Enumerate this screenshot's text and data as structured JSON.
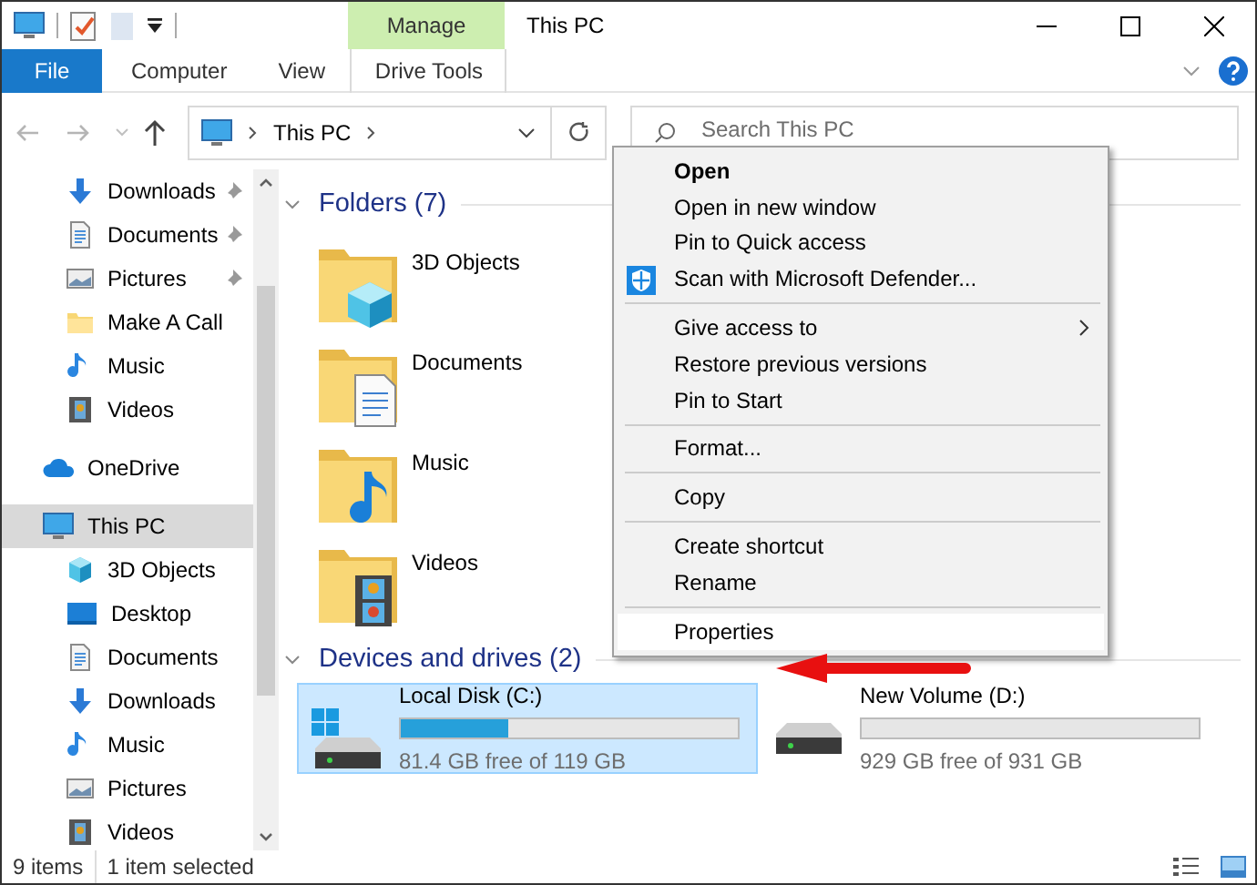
{
  "window": {
    "title": "This PC"
  },
  "ribbon": {
    "context_group": "Manage",
    "tabs": [
      {
        "label": "File",
        "kind": "file",
        "selected": false
      },
      {
        "label": "Computer",
        "kind": "tab",
        "selected": false
      },
      {
        "label": "View",
        "kind": "tab",
        "selected": false
      },
      {
        "label": "Drive Tools",
        "kind": "contextual",
        "selected": false
      }
    ]
  },
  "address_bar": {
    "path": [
      "This PC"
    ]
  },
  "search": {
    "placeholder": "Search This PC"
  },
  "sidebar": {
    "quick_access": {
      "children": [
        {
          "label": "Downloads",
          "kind": "download",
          "pinned": true,
          "selected": false
        },
        {
          "label": "Documents",
          "kind": "documents",
          "pinned": true,
          "selected": false
        },
        {
          "label": "Pictures",
          "kind": "pictures",
          "pinned": true,
          "selected": false
        },
        {
          "label": "Make A Call",
          "kind": "folder",
          "pinned": false,
          "selected": false
        },
        {
          "label": "Music",
          "kind": "music",
          "pinned": false,
          "selected": false
        },
        {
          "label": "Videos",
          "kind": "videos",
          "pinned": false,
          "selected": false
        }
      ]
    },
    "items": [
      {
        "label": "OneDrive",
        "kind": "onedrive",
        "selected": false
      },
      {
        "label": "This PC",
        "kind": "pc",
        "selected": true,
        "children": [
          {
            "label": "3D Objects",
            "kind": "objects",
            "selected": false
          },
          {
            "label": "Desktop",
            "kind": "desktop",
            "selected": false
          },
          {
            "label": "Documents",
            "kind": "documents",
            "selected": false
          },
          {
            "label": "Downloads",
            "kind": "download",
            "selected": false
          },
          {
            "label": "Music",
            "kind": "music",
            "selected": false
          },
          {
            "label": "Pictures",
            "kind": "pictures",
            "selected": false
          },
          {
            "label": "Videos",
            "kind": "videos",
            "selected": false
          }
        ]
      }
    ]
  },
  "folders": {
    "title": "Folders (7)",
    "expanded": true,
    "items": [
      {
        "label": "3D Objects",
        "kind": "objects"
      },
      {
        "label": "Documents",
        "kind": "documents"
      },
      {
        "label": "Music",
        "kind": "music"
      },
      {
        "label": "Videos",
        "kind": "videos"
      }
    ]
  },
  "drives": {
    "title": "Devices and drives (2)",
    "expanded": true,
    "items": [
      {
        "name": "Local Disk (C:)",
        "kind": "system",
        "free": "81.4 GB free of 119 GB",
        "level": 0.32,
        "selected": true
      },
      {
        "name": "New Volume (D:)",
        "kind": "data",
        "free": "929 GB free of 931 GB",
        "level": 0.0,
        "selected": false
      }
    ]
  },
  "context_menu": {
    "items": [
      {
        "kind": "default",
        "label": "Open",
        "selected": false
      },
      {
        "kind": "item",
        "label": "Open in new window",
        "selected": false
      },
      {
        "kind": "item",
        "label": "Pin to Quick access",
        "selected": false
      },
      {
        "kind": "shield",
        "label": "Scan with Microsoft Defender...",
        "selected": false
      },
      {
        "kind": "separator"
      },
      {
        "kind": "submenu",
        "label": "Give access to",
        "selected": false
      },
      {
        "kind": "item",
        "label": "Restore previous versions",
        "selected": false
      },
      {
        "kind": "item",
        "label": "Pin to Start",
        "selected": false
      },
      {
        "kind": "separator"
      },
      {
        "kind": "item",
        "label": "Format...",
        "selected": false
      },
      {
        "kind": "separator"
      },
      {
        "kind": "item",
        "label": "Copy",
        "selected": false
      },
      {
        "kind": "separator"
      },
      {
        "kind": "item",
        "label": "Create shortcut",
        "selected": false
      },
      {
        "kind": "item",
        "label": "Rename",
        "selected": false
      },
      {
        "kind": "separator"
      },
      {
        "kind": "item",
        "label": "Properties",
        "selected": true
      }
    ]
  },
  "status_bar": {
    "item_count": "9 items",
    "selection": "1 item selected"
  }
}
